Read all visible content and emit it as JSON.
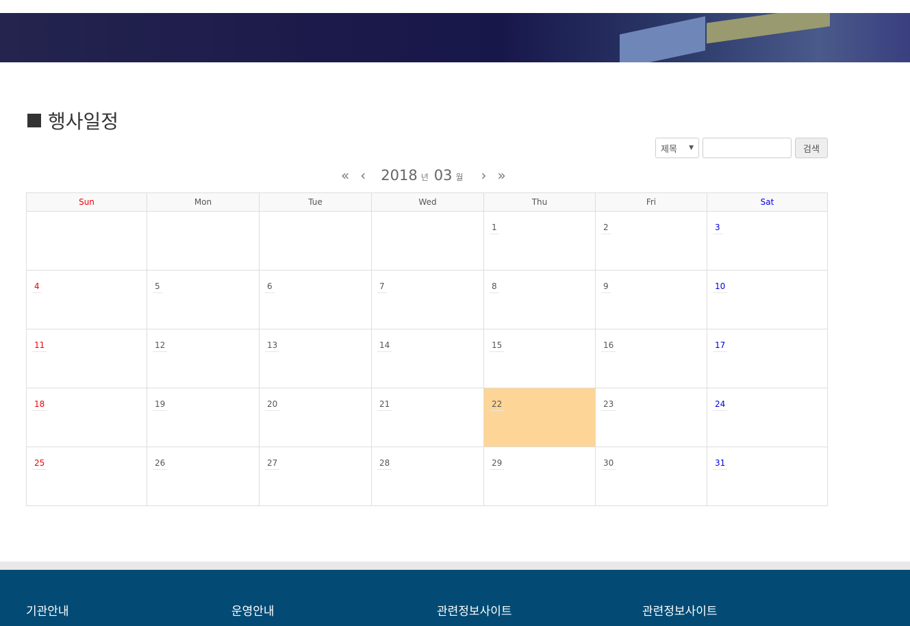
{
  "page": {
    "title": "행사일정"
  },
  "search": {
    "field_selected": "제목",
    "input_value": "",
    "button_label": "검색"
  },
  "nav": {
    "prev_year": "«",
    "prev_month": "‹",
    "year": "2018",
    "year_unit": "년",
    "month": "03",
    "month_unit": "월",
    "next_month": "›",
    "next_year": "»"
  },
  "calendar": {
    "weekdays": [
      "Sun",
      "Mon",
      "Tue",
      "Wed",
      "Thu",
      "Fri",
      "Sat"
    ],
    "weeks": [
      [
        "",
        "",
        "",
        "",
        "1",
        "2",
        "3"
      ],
      [
        "4",
        "5",
        "6",
        "7",
        "8",
        "9",
        "10"
      ],
      [
        "11",
        "12",
        "13",
        "14",
        "15",
        "16",
        "17"
      ],
      [
        "18",
        "19",
        "20",
        "21",
        "22",
        "23",
        "24"
      ],
      [
        "25",
        "26",
        "27",
        "28",
        "29",
        "30",
        "31"
      ]
    ],
    "today": "22",
    "colors": {
      "sunday": "#ee0000",
      "saturday": "#0000dd",
      "today_bg": "#fdd597"
    }
  },
  "footer": {
    "columns": [
      "기관안내",
      "운영안내",
      "관련정보사이트",
      "관련정보사이트"
    ],
    "background": "#034b74"
  }
}
